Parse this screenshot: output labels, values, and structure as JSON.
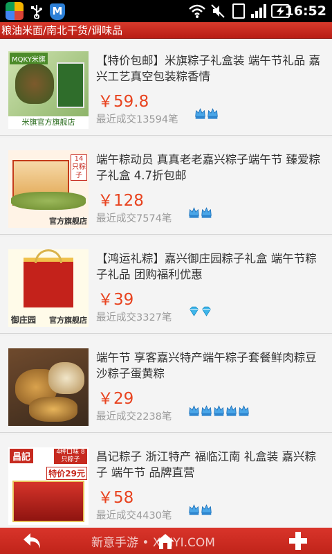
{
  "status_bar": {
    "time": "16:52",
    "icons": [
      "app-launcher-icon",
      "usb-icon",
      "security-shield-icon",
      "wifi-icon",
      "mute-icon",
      "sim-icon",
      "signal-icon",
      "battery-charging-icon"
    ]
  },
  "header": {
    "title": "粮油米面/南北干货/调味品"
  },
  "products": [
    {
      "title": "【特价包邮】米旗粽子礼盒装 端午节礼品 嘉兴工艺真空包装粽香情",
      "price": "￥59.8",
      "sales": "最近成交13594笔",
      "badge_type": "crown",
      "badge_count": 2,
      "thumb_logo": "MQKY米旗",
      "thumb_store": "米旗官方旗舰店"
    },
    {
      "title": "端午粽动员 真真老老嘉兴粽子端午节 臻爱粽子礼盒 4.7折包邮",
      "price": "￥128",
      "sales": "最近成交7574笔",
      "badge_type": "crown",
      "badge_count": 2,
      "thumb_tag": "14只粽子",
      "thumb_store": "官方旗舰店"
    },
    {
      "title": "【鸿运礼粽】嘉兴御庄园粽子礼盒 端午节粽子礼品 团购福利优惠",
      "price": "￥39",
      "sales": "最近成交3327笔",
      "badge_type": "diamond",
      "badge_count": 2,
      "thumb_logo": "御庄园",
      "thumb_store": "官方旗舰店"
    },
    {
      "title": "端午节 享客嘉兴特产端午粽子套餐鲜肉粽豆沙粽子蛋黄粽",
      "price": "￥29",
      "sales": "最近成交2238笔",
      "badge_type": "crown",
      "badge_count": 5
    },
    {
      "title": "昌记粽子 浙江特产 福临江南 礼盒装 嘉兴粽子 端午节 品牌直营",
      "price": "￥58",
      "sales": "最近成交4430笔",
      "badge_type": "crown",
      "badge_count": 2,
      "thumb_logo": "昌記",
      "thumb_tag": "4种口味 8只粽子",
      "thumb_promo": "特价29元"
    }
  ],
  "bottom_bar": {
    "back_icon": "back-arrow-icon",
    "home_icon": "home-icon",
    "add_icon": "plus-icon",
    "watermark": "新意手游 • XINYI.COM"
  },
  "colors": {
    "brand_red": "#c62a1f",
    "price": "#e8431f",
    "muted_text": "#999999",
    "crown_badge": "#4aa6e8",
    "diamond_badge": "#3fb6ea"
  }
}
